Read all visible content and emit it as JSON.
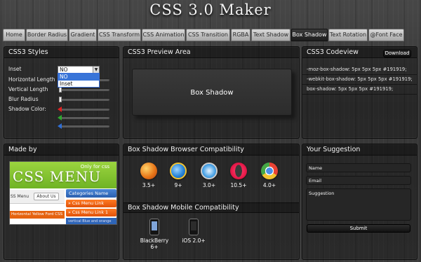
{
  "app": {
    "title": "CSS 3.0 Maker"
  },
  "nav": {
    "tabs": [
      {
        "label": "Home",
        "active": false
      },
      {
        "label": "Border Radius",
        "active": false
      },
      {
        "label": "Gradient",
        "active": false
      },
      {
        "label": "CSS Transform",
        "active": false
      },
      {
        "label": "CSS Animation",
        "active": false
      },
      {
        "label": "CSS Transition",
        "active": false
      },
      {
        "label": "RGBA",
        "active": false
      },
      {
        "label": "Text Shadow",
        "active": false
      },
      {
        "label": "Box Shadow",
        "active": true
      },
      {
        "label": "Text Rotation",
        "active": false
      },
      {
        "label": "@Font Face",
        "active": false
      }
    ]
  },
  "styles_panel": {
    "title": "CSS3 Styles",
    "fields": {
      "inset": "Inset",
      "horizontal_length": "Horizontal Length",
      "vertical_length": "Vertical Length",
      "blur_radius": "Blur Radius",
      "shadow_color": "Shadow Color:"
    },
    "inset_select": {
      "value": "NO",
      "options": [
        "NO",
        "Inset"
      ]
    },
    "color_arrows": [
      "#e02020",
      "#2fa82f",
      "#2f6fd6"
    ]
  },
  "preview_panel": {
    "title": "CSS3 Preview Area",
    "preview_label": "Box Shadow"
  },
  "codeview_panel": {
    "title": "CSS3 Codeview",
    "download_label": "Download",
    "lines": [
      "-moz-box-shadow: 5px 5px 5px #191919;",
      "-webkit-box-shadow: 5px 5px 5px #191919;",
      "box-shadow: 5px 5px 5px #191919;"
    ]
  },
  "madeby_panel": {
    "title": "Made by",
    "banner": {
      "small_text": "Only for css",
      "big_text": "CSS MENU",
      "menu_text": "SS Menu",
      "about": "About Us",
      "categories": "Categories Name",
      "link1": "» Css Menu Link",
      "link2": "» Css Menu Link 1",
      "footer": "Horizontal Yellow Ford CSS",
      "sub_text": "vertical Blue and orange menu"
    }
  },
  "compat_panel": {
    "title": "Box Shadow Browser Compatibility",
    "browsers": [
      {
        "name": "firefox-icon",
        "version": "3.5+",
        "color": "#e8781a"
      },
      {
        "name": "ie-icon",
        "version": "9+",
        "color": "#2a86d9"
      },
      {
        "name": "safari-icon",
        "version": "3.0+",
        "color": "#4aa3e6"
      },
      {
        "name": "opera-icon",
        "version": "10.5+",
        "color": "#e8194a"
      },
      {
        "name": "chrome-icon",
        "version": "4.0+",
        "color": "#46a846"
      }
    ],
    "mobile_title": "Box Shadow Mobile Compatibility",
    "devices": [
      {
        "name": "BlackBerry",
        "version": "6+"
      },
      {
        "name": "iOS 2.0+",
        "version": ""
      }
    ]
  },
  "suggestion_panel": {
    "title": "Your Suggestion",
    "name_label": "Name",
    "email_label": "Email",
    "suggestion_label": "Suggestion",
    "submit_label": "Submit"
  }
}
